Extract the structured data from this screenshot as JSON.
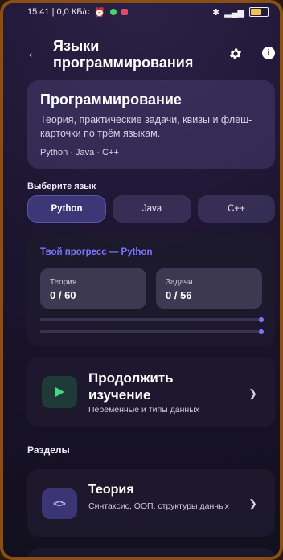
{
  "status_bar": {
    "time_net": "15:41 | 0,0 КБ/с",
    "alarm_icon": "alarm-icon",
    "signal": "4G"
  },
  "header": {
    "title": "Языки программирования"
  },
  "intro": {
    "title": "Программирование",
    "description": "Теория, практические задачи, квизы и флеш-карточки по трём языкам.",
    "languages": "Python  ·  Java  ·  C++"
  },
  "language_select": {
    "label": "Выберите язык",
    "options": [
      "Python",
      "Java",
      "C++"
    ],
    "selected": "Python"
  },
  "progress": {
    "title": "Твой прогресс — Python",
    "stats": [
      {
        "label": "Теория",
        "value": "0 / 60"
      },
      {
        "label": "Задачи",
        "value": "0 / 56"
      }
    ]
  },
  "continue": {
    "title": "Продолжить изучение",
    "subtitle": "Переменные и типы данных"
  },
  "sections": {
    "label": "Разделы",
    "items": [
      {
        "title": "Теория",
        "subtitle": "Синтаксис, ООП, структуры данных"
      }
    ]
  },
  "colors": {
    "accent": "#7c74ff",
    "play": "#3ddc84"
  }
}
